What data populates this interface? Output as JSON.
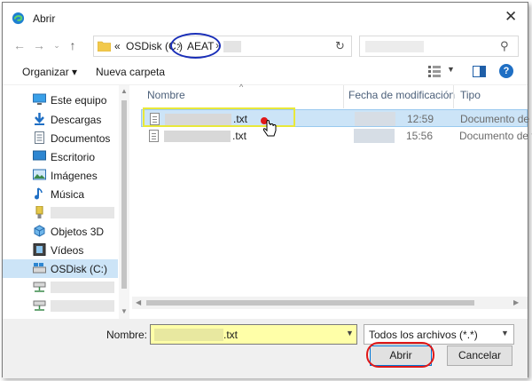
{
  "window": {
    "title": "Abrir",
    "close_symbol": "✕"
  },
  "nav": {
    "back_icon": "arrow-left-icon",
    "forward_icon": "arrow-right-icon",
    "recent_icon": "chevron-down-icon",
    "up_icon": "arrow-up-icon",
    "address": {
      "prefix": "«",
      "segments": [
        "OSDisk (C:)",
        "AEAT"
      ],
      "separator": "›"
    },
    "refresh_icon": "refresh-icon",
    "search_icon": "search-icon"
  },
  "toolbar": {
    "organize_label": "Organizar ▾",
    "new_folder_label": "Nueva carpeta",
    "help_label": "?"
  },
  "sidebar": {
    "items": [
      {
        "label": "Este equipo",
        "icon": "computer-icon"
      },
      {
        "label": "Descargas",
        "icon": "download-icon"
      },
      {
        "label": "Documentos",
        "icon": "documents-icon"
      },
      {
        "label": "Escritorio",
        "icon": "desktop-icon"
      },
      {
        "label": "Imágenes",
        "icon": "pictures-icon"
      },
      {
        "label": "Música",
        "icon": "music-icon"
      },
      {
        "label": "",
        "icon": "usb-drive-icon"
      },
      {
        "label": "Objetos 3D",
        "icon": "objects-3d-icon"
      },
      {
        "label": "Vídeos",
        "icon": "videos-icon"
      },
      {
        "label": "OSDisk (C:)",
        "icon": "disk-icon",
        "selected": true
      },
      {
        "label": "",
        "icon": "network-drive-icon"
      },
      {
        "label": "",
        "icon": "network-drive-icon"
      }
    ]
  },
  "filelist": {
    "columns": [
      "Nombre",
      "Fecha de modificación",
      "Tipo"
    ],
    "rows": [
      {
        "name_ext": ".txt",
        "time": "12:59",
        "type": "Documento de t",
        "selected": true
      },
      {
        "name_ext": ".txt",
        "time": "15:56",
        "type": "Documento de t",
        "selected": false
      }
    ]
  },
  "bottom": {
    "name_label": "Nombre:",
    "name_value_ext": ".txt",
    "filter_value": "Todos los archivos (*.*)",
    "open_label": "Abrir",
    "cancel_label": "Cancelar"
  },
  "colors": {
    "accent": "#0078d7",
    "selection": "#cce4f7",
    "annotation_blue": "#1a2fb8",
    "annotation_yellow": "#e8e83a",
    "annotation_red": "#e01818"
  }
}
